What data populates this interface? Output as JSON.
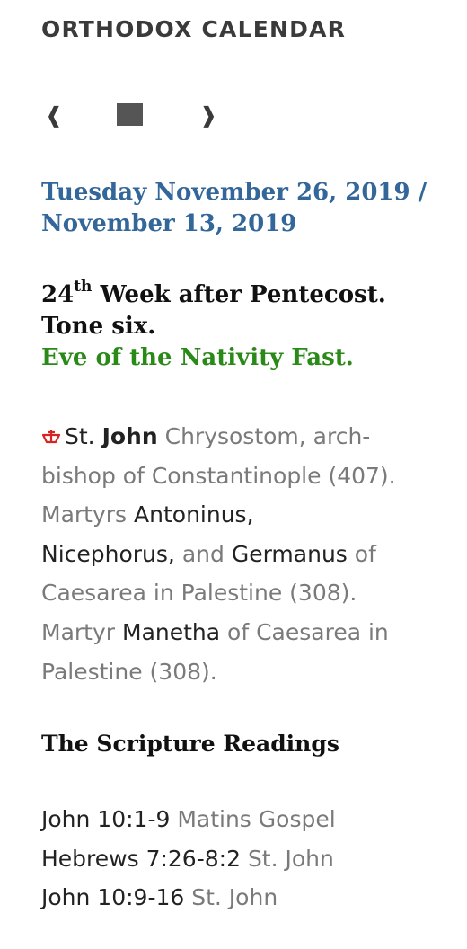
{
  "app": {
    "title": "ORTHODOX CALENDAR"
  },
  "nav": {
    "prev_label": "❰",
    "next_label": "❱",
    "today_icon": "square-icon"
  },
  "date": {
    "line1": "Tuesday November 26, 2019 /",
    "line2": "November 13, 2019"
  },
  "week": {
    "number": "24",
    "suffix": "th",
    "text": "Week after Pentecost.",
    "tone": "Tone six.",
    "fast": "Eve of the Nativity Fast."
  },
  "saints": {
    "icon": "great-feast-cross-icon",
    "s1_prefix": "St.",
    "s1_name": "John",
    "s1_rest": "Chrysostom, arch-bishop of Constantinople (407).",
    "s2_prefix": "Martyrs",
    "s2_name1": "Antoninus,",
    "s2_name2": "Nicephorus,",
    "s2_and": "and",
    "s2_name3": "Germanus",
    "s2_rest": "of Caesarea in Palestine (308).",
    "s3_prefix": "Martyr",
    "s3_name": "Manetha",
    "s3_rest": "of Caesarea in Palestine (308)."
  },
  "scripture": {
    "title": "The Scripture Readings",
    "readings": [
      {
        "ref": "John 10:1-9",
        "desc": "Matins Gospel"
      },
      {
        "ref": "Hebrews 7:26-8:2",
        "desc": "St. John"
      },
      {
        "ref": "John 10:9-16",
        "desc": "St. John"
      }
    ]
  },
  "colors": {
    "date": "#336699",
    "fast": "#2a8a18",
    "muted": "#7a7a7a",
    "icon_red": "#d92323"
  }
}
